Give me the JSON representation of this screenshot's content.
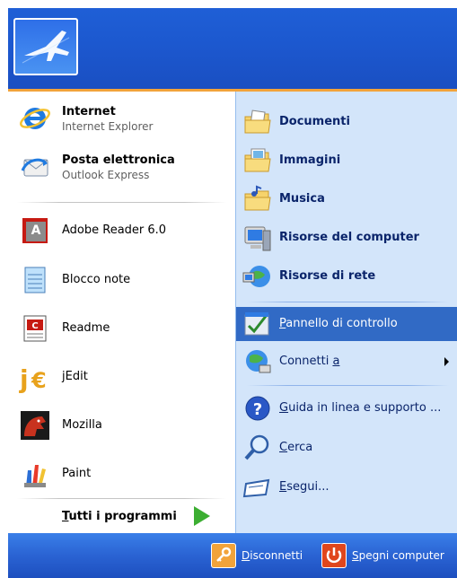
{
  "left_items": [
    {
      "name": "internet-item",
      "title": "Internet",
      "subtitle": "Internet Explorer",
      "icon": "internet-explorer-icon",
      "bold": true
    },
    {
      "name": "email-item",
      "title": "Posta elettronica",
      "subtitle": "Outlook Express",
      "icon": "outlook-express-icon",
      "bold": true
    },
    {
      "name": "adobe-reader-item",
      "title": "Adobe Reader 6.0",
      "icon": "adobe-reader-icon"
    },
    {
      "name": "notepad-item",
      "title": "Blocco note",
      "icon": "notepad-icon"
    },
    {
      "name": "readme-item",
      "title": "Readme",
      "icon": "readme-icon"
    },
    {
      "name": "jedit-item",
      "title": "jEdit",
      "icon": "jedit-icon"
    },
    {
      "name": "mozilla-item",
      "title": "Mozilla",
      "icon": "mozilla-icon"
    },
    {
      "name": "paint-item",
      "title": "Paint",
      "icon": "paint-icon"
    }
  ],
  "all_programs": {
    "prefix": "T",
    "rest": "utti i programmi",
    "icon": "green-arrow-icon"
  },
  "right_items": [
    {
      "name": "documents",
      "label": "Documenti",
      "bold": true,
      "icon": "documents-folder-icon"
    },
    {
      "name": "pictures",
      "label": "Immagini",
      "bold": true,
      "icon": "pictures-folder-icon"
    },
    {
      "name": "music",
      "label": "Musica",
      "bold": true,
      "icon": "music-folder-icon"
    },
    {
      "name": "my-computer",
      "label": "Risorse del computer",
      "bold": true,
      "icon": "computer-icon"
    },
    {
      "name": "network",
      "label": "Risorse di rete",
      "bold": true,
      "icon": "network-icon"
    },
    {
      "name": "control-panel",
      "label_prefix": "P",
      "label_rest": "annello di controllo",
      "icon": "control-panel-icon",
      "highlighted": true
    },
    {
      "name": "connect-to",
      "label_prefix": "Connetti ",
      "label_u": "a",
      "icon": "connect-globe-icon",
      "submenu": true
    },
    {
      "name": "help",
      "label_prefix": "G",
      "label_rest": "uida in linea e supporto ...",
      "icon": "help-icon"
    },
    {
      "name": "search",
      "label_prefix": "C",
      "label_rest": "erca",
      "icon": "search-icon"
    },
    {
      "name": "run",
      "label_prefix": "E",
      "label_rest": "segui...",
      "icon": "run-icon"
    }
  ],
  "footer": {
    "logoff": {
      "prefix": "D",
      "rest": "isconnetti",
      "icon": "logoff-key-icon"
    },
    "shutdown": {
      "prefix": "S",
      "rest": "pegni computer",
      "icon": "power-icon"
    }
  },
  "colors": {
    "header": "#1c58cf",
    "accent": "#f2a33a",
    "right_panel": "#d3e5fa",
    "highlight": "#316ac5"
  }
}
